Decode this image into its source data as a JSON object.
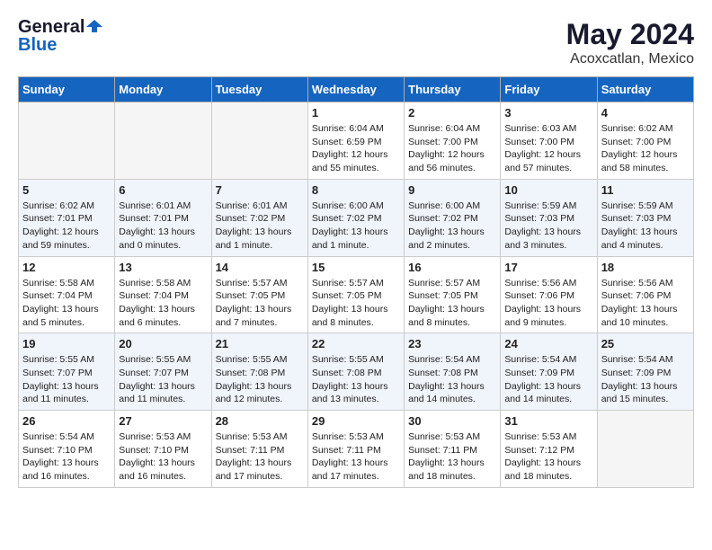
{
  "header": {
    "logo_general": "General",
    "logo_blue": "Blue",
    "month_year": "May 2024",
    "location": "Acoxcatlan, Mexico"
  },
  "days_of_week": [
    "Sunday",
    "Monday",
    "Tuesday",
    "Wednesday",
    "Thursday",
    "Friday",
    "Saturday"
  ],
  "weeks": [
    {
      "days": [
        {
          "number": "",
          "info": ""
        },
        {
          "number": "",
          "info": ""
        },
        {
          "number": "",
          "info": ""
        },
        {
          "number": "1",
          "info": "Sunrise: 6:04 AM\nSunset: 6:59 PM\nDaylight: 12 hours and 55 minutes."
        },
        {
          "number": "2",
          "info": "Sunrise: 6:04 AM\nSunset: 7:00 PM\nDaylight: 12 hours and 56 minutes."
        },
        {
          "number": "3",
          "info": "Sunrise: 6:03 AM\nSunset: 7:00 PM\nDaylight: 12 hours and 57 minutes."
        },
        {
          "number": "4",
          "info": "Sunrise: 6:02 AM\nSunset: 7:00 PM\nDaylight: 12 hours and 58 minutes."
        }
      ]
    },
    {
      "days": [
        {
          "number": "5",
          "info": "Sunrise: 6:02 AM\nSunset: 7:01 PM\nDaylight: 12 hours and 59 minutes."
        },
        {
          "number": "6",
          "info": "Sunrise: 6:01 AM\nSunset: 7:01 PM\nDaylight: 13 hours and 0 minutes."
        },
        {
          "number": "7",
          "info": "Sunrise: 6:01 AM\nSunset: 7:02 PM\nDaylight: 13 hours and 1 minute."
        },
        {
          "number": "8",
          "info": "Sunrise: 6:00 AM\nSunset: 7:02 PM\nDaylight: 13 hours and 1 minute."
        },
        {
          "number": "9",
          "info": "Sunrise: 6:00 AM\nSunset: 7:02 PM\nDaylight: 13 hours and 2 minutes."
        },
        {
          "number": "10",
          "info": "Sunrise: 5:59 AM\nSunset: 7:03 PM\nDaylight: 13 hours and 3 minutes."
        },
        {
          "number": "11",
          "info": "Sunrise: 5:59 AM\nSunset: 7:03 PM\nDaylight: 13 hours and 4 minutes."
        }
      ]
    },
    {
      "days": [
        {
          "number": "12",
          "info": "Sunrise: 5:58 AM\nSunset: 7:04 PM\nDaylight: 13 hours and 5 minutes."
        },
        {
          "number": "13",
          "info": "Sunrise: 5:58 AM\nSunset: 7:04 PM\nDaylight: 13 hours and 6 minutes."
        },
        {
          "number": "14",
          "info": "Sunrise: 5:57 AM\nSunset: 7:05 PM\nDaylight: 13 hours and 7 minutes."
        },
        {
          "number": "15",
          "info": "Sunrise: 5:57 AM\nSunset: 7:05 PM\nDaylight: 13 hours and 8 minutes."
        },
        {
          "number": "16",
          "info": "Sunrise: 5:57 AM\nSunset: 7:05 PM\nDaylight: 13 hours and 8 minutes."
        },
        {
          "number": "17",
          "info": "Sunrise: 5:56 AM\nSunset: 7:06 PM\nDaylight: 13 hours and 9 minutes."
        },
        {
          "number": "18",
          "info": "Sunrise: 5:56 AM\nSunset: 7:06 PM\nDaylight: 13 hours and 10 minutes."
        }
      ]
    },
    {
      "days": [
        {
          "number": "19",
          "info": "Sunrise: 5:55 AM\nSunset: 7:07 PM\nDaylight: 13 hours and 11 minutes."
        },
        {
          "number": "20",
          "info": "Sunrise: 5:55 AM\nSunset: 7:07 PM\nDaylight: 13 hours and 11 minutes."
        },
        {
          "number": "21",
          "info": "Sunrise: 5:55 AM\nSunset: 7:08 PM\nDaylight: 13 hours and 12 minutes."
        },
        {
          "number": "22",
          "info": "Sunrise: 5:55 AM\nSunset: 7:08 PM\nDaylight: 13 hours and 13 minutes."
        },
        {
          "number": "23",
          "info": "Sunrise: 5:54 AM\nSunset: 7:08 PM\nDaylight: 13 hours and 14 minutes."
        },
        {
          "number": "24",
          "info": "Sunrise: 5:54 AM\nSunset: 7:09 PM\nDaylight: 13 hours and 14 minutes."
        },
        {
          "number": "25",
          "info": "Sunrise: 5:54 AM\nSunset: 7:09 PM\nDaylight: 13 hours and 15 minutes."
        }
      ]
    },
    {
      "days": [
        {
          "number": "26",
          "info": "Sunrise: 5:54 AM\nSunset: 7:10 PM\nDaylight: 13 hours and 16 minutes."
        },
        {
          "number": "27",
          "info": "Sunrise: 5:53 AM\nSunset: 7:10 PM\nDaylight: 13 hours and 16 minutes."
        },
        {
          "number": "28",
          "info": "Sunrise: 5:53 AM\nSunset: 7:11 PM\nDaylight: 13 hours and 17 minutes."
        },
        {
          "number": "29",
          "info": "Sunrise: 5:53 AM\nSunset: 7:11 PM\nDaylight: 13 hours and 17 minutes."
        },
        {
          "number": "30",
          "info": "Sunrise: 5:53 AM\nSunset: 7:11 PM\nDaylight: 13 hours and 18 minutes."
        },
        {
          "number": "31",
          "info": "Sunrise: 5:53 AM\nSunset: 7:12 PM\nDaylight: 13 hours and 18 minutes."
        },
        {
          "number": "",
          "info": ""
        }
      ]
    }
  ]
}
